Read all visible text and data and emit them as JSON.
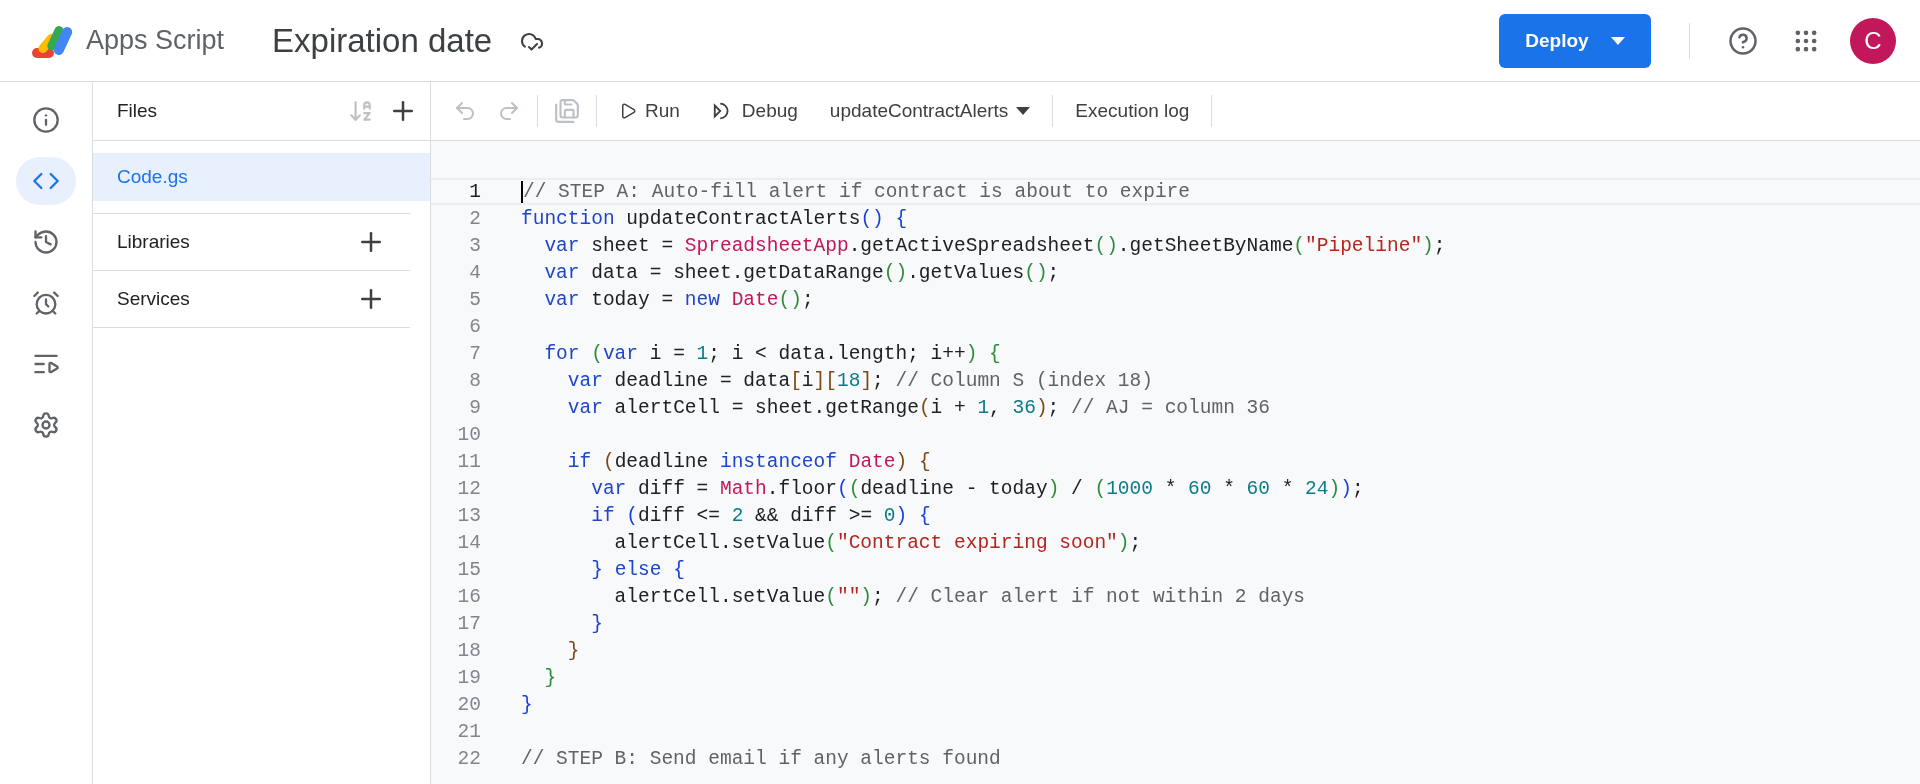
{
  "app": {
    "name": "Apps Script"
  },
  "project": {
    "title": "Expiration date"
  },
  "header": {
    "deploy": "Deploy",
    "avatar": "C"
  },
  "rail": [
    {
      "kind": "info",
      "selected": false
    },
    {
      "kind": "code",
      "selected": true
    },
    {
      "kind": "history",
      "selected": false
    },
    {
      "kind": "alarm",
      "selected": false
    },
    {
      "kind": "executions",
      "selected": false
    },
    {
      "kind": "settings",
      "selected": false
    }
  ],
  "files_panel": {
    "title": "Files",
    "files": [
      {
        "name": "Code.gs",
        "selected": true
      }
    ],
    "sections": [
      "Libraries",
      "Services"
    ]
  },
  "toolbar": {
    "run": "Run",
    "debug": "Debug",
    "function": "updateContractAlerts",
    "log": "Execution log"
  },
  "editor": {
    "lines": [
      {
        "number": "1",
        "selected": true,
        "tokens": [
          {
            "kind": "comment",
            "text": "// STEP A: Auto-fill alert if contract is about to expire"
          }
        ]
      },
      {
        "number": "2",
        "selected": false,
        "tokens": [
          {
            "kind": "keyword",
            "text": "function"
          },
          {
            "kind": "plain",
            "text": " updateContractAlerts() {"
          }
        ]
      },
      {
        "number": "3",
        "selected": false,
        "tokens": [
          {
            "kind": "keyword",
            "text": "  var"
          },
          {
            "kind": "plain",
            "text": " sheet = "
          },
          {
            "kind": "builtin",
            "text": "SpreadsheetApp"
          },
          {
            "kind": "plain",
            "text": ".getActiveSpreadsheet().getSheetByName("
          },
          {
            "kind": "string",
            "text": "\"Pipeline\""
          },
          {
            "kind": "plain",
            "text": ");"
          }
        ]
      },
      {
        "number": "4",
        "selected": false,
        "tokens": [
          {
            "kind": "keyword",
            "text": "  var"
          },
          {
            "kind": "plain",
            "text": " data = sheet.getDataRange().getValues();"
          }
        ]
      },
      {
        "number": "5",
        "selected": false,
        "tokens": [
          {
            "kind": "keyword",
            "text": "  var"
          },
          {
            "kind": "plain",
            "text": " today = "
          },
          {
            "kind": "keyword",
            "text": "new "
          },
          {
            "kind": "builtin",
            "text": "Date"
          },
          {
            "kind": "plain",
            "text": "();"
          }
        ]
      },
      {
        "number": "6",
        "selected": false
      },
      {
        "number": "7",
        "selected": false,
        "tokens": [
          {
            "kind": "keyword",
            "text": "  for"
          },
          {
            "kind": "plain",
            "text": " ("
          },
          {
            "kind": "keyword",
            "text": "var"
          },
          {
            "kind": "plain",
            "text": " i = "
          },
          {
            "kind": "number",
            "text": "1"
          },
          {
            "kind": "plain",
            "text": "; i < data.length; i++) {"
          }
        ]
      },
      {
        "number": "8",
        "selected": false,
        "tokens": [
          {
            "kind": "keyword",
            "text": "    var"
          },
          {
            "kind": "plain",
            "text": " deadline = data[i]["
          },
          {
            "kind": "number",
            "text": "18"
          },
          {
            "kind": "plain",
            "text": "]; "
          },
          {
            "kind": "comment",
            "text": "// Column S (index 18)"
          }
        ]
      },
      {
        "number": "9",
        "selected": false,
        "tokens": [
          {
            "kind": "keyword",
            "text": "    var"
          },
          {
            "kind": "plain",
            "text": " alertCell = sheet.getRange(i + "
          },
          {
            "kind": "number",
            "text": "1"
          },
          {
            "kind": "plain",
            "text": ", "
          },
          {
            "kind": "number",
            "text": "36"
          },
          {
            "kind": "plain",
            "text": "); "
          },
          {
            "kind": "comment",
            "text": "// AJ = column 36"
          }
        ]
      },
      {
        "number": "10",
        "selected": false
      },
      {
        "number": "11",
        "selected": false,
        "tokens": [
          {
            "kind": "keyword",
            "text": "    if"
          },
          {
            "kind": "plain",
            "text": " (deadline "
          },
          {
            "kind": "keyword",
            "text": "instanceof "
          },
          {
            "kind": "builtin",
            "text": "Date"
          },
          {
            "kind": "plain",
            "text": ") {"
          }
        ]
      },
      {
        "number": "12",
        "selected": false,
        "tokens": [
          {
            "kind": "keyword",
            "text": "      var"
          },
          {
            "kind": "plain",
            "text": " diff = "
          },
          {
            "kind": "builtin",
            "text": "Math"
          },
          {
            "kind": "plain",
            "text": ".floor((deadline - today) / ("
          },
          {
            "kind": "number",
            "text": "1000"
          },
          {
            "kind": "plain",
            "text": " * "
          },
          {
            "kind": "number",
            "text": "60"
          },
          {
            "kind": "plain",
            "text": " * "
          },
          {
            "kind": "number",
            "text": "60"
          },
          {
            "kind": "plain",
            "text": " * "
          },
          {
            "kind": "number",
            "text": "24"
          },
          {
            "kind": "plain",
            "text": "));"
          }
        ]
      },
      {
        "number": "13",
        "selected": false,
        "tokens": [
          {
            "kind": "keyword",
            "text": "      if"
          },
          {
            "kind": "plain",
            "text": " (diff <= "
          },
          {
            "kind": "number",
            "text": "2"
          },
          {
            "kind": "plain",
            "text": " && diff >= "
          },
          {
            "kind": "number",
            "text": "0"
          },
          {
            "kind": "plain",
            "text": ") {"
          }
        ]
      },
      {
        "number": "14",
        "selected": false,
        "tokens": [
          {
            "kind": "plain",
            "text": "        alertCell.setValue("
          },
          {
            "kind": "string",
            "text": "\"Contract expiring soon\""
          },
          {
            "kind": "plain",
            "text": ");"
          }
        ]
      },
      {
        "number": "15",
        "selected": false,
        "tokens": [
          {
            "kind": "plain",
            "text": "      } "
          },
          {
            "kind": "keyword",
            "text": "else"
          },
          {
            "kind": "plain",
            "text": " {"
          }
        ]
      },
      {
        "number": "16",
        "selected": false,
        "tokens": [
          {
            "kind": "plain",
            "text": "        alertCell.setValue("
          },
          {
            "kind": "string",
            "text": "\"\""
          },
          {
            "kind": "plain",
            "text": "); "
          },
          {
            "kind": "comment",
            "text": "// Clear alert if not within 2 days"
          }
        ]
      },
      {
        "number": "17",
        "selected": false,
        "tokens": [
          {
            "kind": "plain",
            "text": "      }"
          }
        ]
      },
      {
        "number": "18",
        "selected": false,
        "tokens": [
          {
            "kind": "plain",
            "text": "    }"
          }
        ]
      },
      {
        "number": "19",
        "selected": false,
        "tokens": [
          {
            "kind": "plain",
            "text": "  }"
          }
        ]
      },
      {
        "number": "20",
        "selected": false,
        "tokens": [
          {
            "kind": "plain",
            "text": "}"
          }
        ]
      },
      {
        "number": "21",
        "selected": false
      },
      {
        "number": "22",
        "selected": false,
        "tokens": [
          {
            "kind": "comment",
            "text": "// STEP B: Send email if any alerts found"
          }
        ]
      }
    ]
  }
}
